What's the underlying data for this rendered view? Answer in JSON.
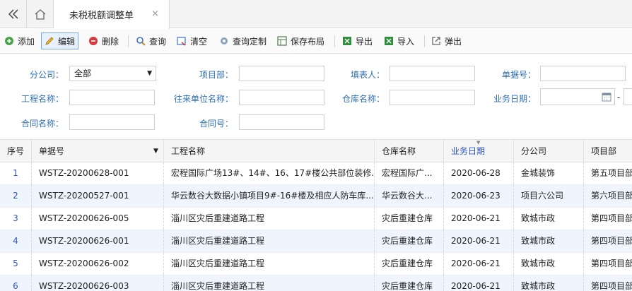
{
  "tabs": {
    "active_title": "未税税额调整单",
    "close_glyph": "×"
  },
  "toolbar": {
    "add": "添加",
    "edit": "编辑",
    "delete": "删除",
    "query": "查询",
    "clear": "清空",
    "query_custom": "查询定制",
    "save_layout": "保存布局",
    "export": "导出",
    "import": "导入",
    "popup": "弹出"
  },
  "form": {
    "branch_label": "分公司：",
    "branch_value": "全部",
    "project_dept_label": "项目部：",
    "filler_label": "填表人：",
    "doc_no_label": "单据号：",
    "project_name_label": "工程名称：",
    "partner_label": "往来单位名称：",
    "warehouse_label": "仓库名称：",
    "biz_date_label": "业务日期：",
    "date_dash": "-",
    "contract_name_label": "合同名称：",
    "contract_no_label": "合同号："
  },
  "grid": {
    "columns": [
      "序号",
      "单据号",
      "工程名称",
      "仓库名称",
      "业务日期",
      "分公司",
      "项目部"
    ],
    "rows": [
      {
        "idx": "1",
        "doc": "WSTZ-20200628-001",
        "project": "宏程国际广场13#、14#、16、17#楼公共部位装修...",
        "warehouse": "宏程国际广...",
        "date": "2020-06-28",
        "branch": "金城装饰",
        "dept": "第五项目部"
      },
      {
        "idx": "2",
        "doc": "WSTZ-20200527-001",
        "project": "华云数谷大数据小镇项目9#-16#楼及相应人防车库...",
        "warehouse": "华云数谷大...",
        "date": "2020-06-23",
        "branch": "项目六公司",
        "dept": "第六项目部"
      },
      {
        "idx": "3",
        "doc": "WSTZ-20200626-005",
        "project": "淄川区灾后重建道路工程",
        "warehouse": "灾后重建仓库",
        "date": "2020-06-21",
        "branch": "致城市政",
        "dept": "第四项目部"
      },
      {
        "idx": "4",
        "doc": "WSTZ-20200626-001",
        "project": "淄川区灾后重建道路工程",
        "warehouse": "灾后重建仓库",
        "date": "2020-06-21",
        "branch": "致城市政",
        "dept": "第四项目部"
      },
      {
        "idx": "5",
        "doc": "WSTZ-20200626-002",
        "project": "淄川区灾后重建道路工程",
        "warehouse": "灾后重建仓库",
        "date": "2020-06-21",
        "branch": "致城市政",
        "dept": "第四项目部"
      },
      {
        "idx": "6",
        "doc": "WSTZ-20200626-003",
        "project": "淄川区灾后重建道路工程",
        "warehouse": "灾后重建仓库",
        "date": "2020-06-21",
        "branch": "致城市政",
        "dept": "第四项目部"
      }
    ]
  },
  "colors": {
    "accent_blue": "#2e6fb8",
    "sort_blue": "#2e55c7",
    "alt_row": "#eef5fd"
  }
}
